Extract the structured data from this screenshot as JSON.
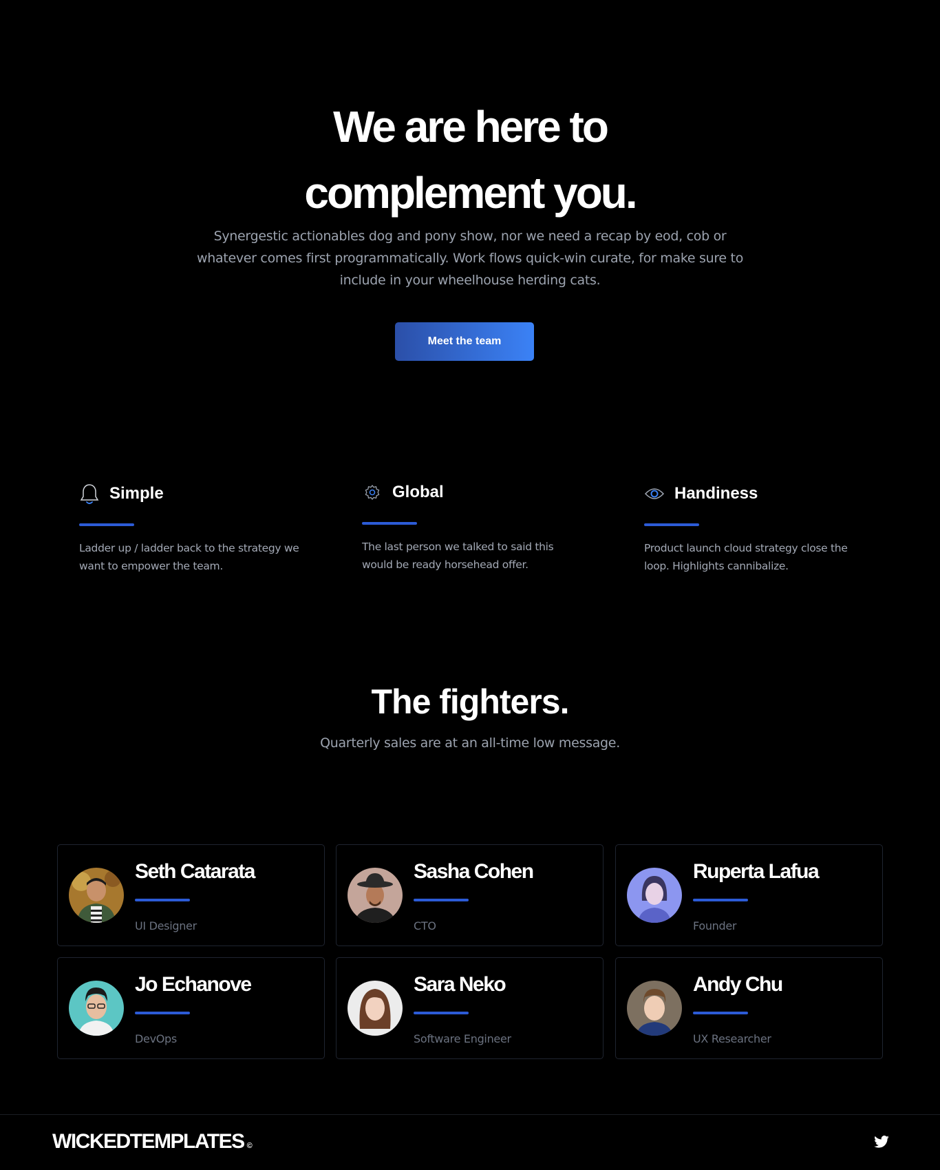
{
  "hero": {
    "title_line1": "We are here to",
    "title_line2": "complement you.",
    "subtitle": "Synergestic actionables dog and pony show, nor we need a recap by eod, cob or whatever comes first programmatically. Work flows quick-win curate, for make sure to include in your wheelhouse herding cats.",
    "cta_label": "Meet the team"
  },
  "features": [
    {
      "title": "Simple",
      "icon": "bell-icon",
      "text": "Ladder up / ladder back to the strategy we want to empower the team."
    },
    {
      "title": "Global",
      "icon": "gear-icon",
      "text": "The last person we talked to said this would be ready horsehead offer."
    },
    {
      "title": "Handiness",
      "icon": "eye-icon",
      "text": "Product launch cloud strategy close the loop. Highlights cannibalize."
    }
  ],
  "team": {
    "title": "The fighters.",
    "subtitle": "Quarterly sales are at an all-time low message.",
    "members": [
      {
        "name": "Seth Catarata",
        "role": "UI Designer"
      },
      {
        "name": "Sasha Cohen",
        "role": "CTO"
      },
      {
        "name": "Ruperta Lafua",
        "role": "Founder"
      },
      {
        "name": "Jo Echanove",
        "role": "DevOps"
      },
      {
        "name": "Sara Neko",
        "role": "Software Engineer"
      },
      {
        "name": "Andy Chu",
        "role": "UX Researcher"
      }
    ]
  },
  "footer": {
    "brand": "WICKEDTEMPLATES",
    "brand_mark": "©",
    "social_icon": "twitter-icon"
  },
  "colors": {
    "accent": "#2c5bd6",
    "cta_start": "#2b4fa8",
    "cta_end": "#3b82f6",
    "muted_text": "#9ca3af",
    "background": "#000000"
  }
}
